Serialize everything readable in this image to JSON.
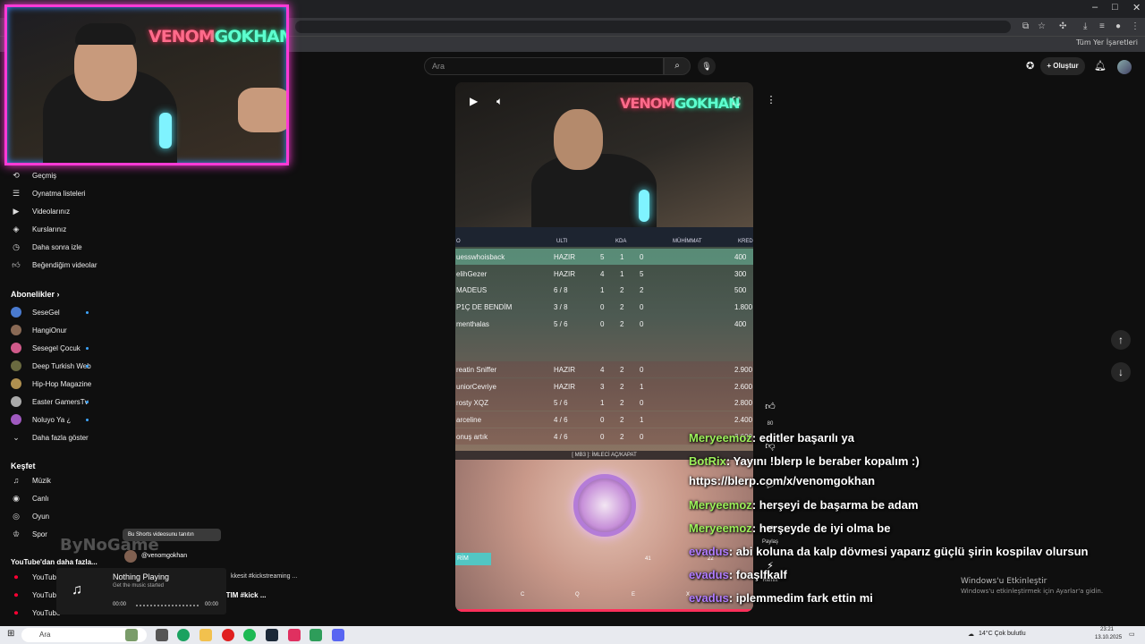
{
  "webcam": {
    "neon_a": "VENOM",
    "neon_b": "GOKHAN"
  },
  "browser": {
    "bookmarks_label": "Tüm Yer İşaretleri",
    "window_min": "–",
    "window_max": "□",
    "window_close": "✕"
  },
  "header": {
    "search_placeholder": "Ara",
    "create_label": "Oluştur"
  },
  "sidebar": {
    "you_items": [
      {
        "label": "Geçmiş",
        "icon": "history-icon"
      },
      {
        "label": "Oynatma listeleri",
        "icon": "playlist-icon"
      },
      {
        "label": "Videolarınız",
        "icon": "your-videos-icon"
      },
      {
        "label": "Kurslarınız",
        "icon": "courses-icon"
      },
      {
        "label": "Daha sonra izle",
        "icon": "watch-later-icon"
      },
      {
        "label": "Beğendiğim videolar",
        "icon": "like-icon"
      }
    ],
    "subs_heading": "Abonelikler",
    "subs_chevron": "›",
    "subscriptions": [
      {
        "label": "SeseGel",
        "color": "#4a7bd0",
        "live": true
      },
      {
        "label": "HangiOnur",
        "color": "#8a6a55",
        "live": false
      },
      {
        "label": "Sesegel Çocuk",
        "color": "#d05a8a",
        "live": true
      },
      {
        "label": "Deep Turkish Web",
        "color": "#6a6a40",
        "live": true
      },
      {
        "label": "Hip-Hop Magazine",
        "color": "#b09050",
        "live": false
      },
      {
        "label": "Easter GamersTv",
        "color": "#aaa",
        "live": true
      },
      {
        "label": "Noluyo Ya ¿",
        "color": "#a05ac0",
        "live": true
      }
    ],
    "show_more": "Daha fazla göster",
    "explore_heading": "Keşfet",
    "explore_items": [
      {
        "label": "Müzik",
        "icon": "music-icon"
      },
      {
        "label": "Canlı",
        "icon": "live-icon"
      },
      {
        "label": "Oyun",
        "icon": "gaming-icon"
      },
      {
        "label": "Spor",
        "icon": "trophy-icon"
      }
    ],
    "more_heading": "YouTube'dan daha fazla...",
    "more_items": [
      "YouTube",
      "YouTube",
      "YouTube"
    ]
  },
  "scoreboard": {
    "headers": {
      "a": "O",
      "ulti": "ULTI",
      "kda": "KDA",
      "ammo": "MÜHİMMAT",
      "credits": "KRED"
    },
    "team_a": [
      {
        "name": "uesswhoisback",
        "ulti": "HAZIR",
        "k": "5",
        "d": "1",
        "a": "0",
        "credits": "400"
      },
      {
        "name": "elihGezer",
        "ulti": "HAZIR",
        "k": "4",
        "d": "1",
        "a": "5",
        "credits": "300"
      },
      {
        "name": "MADEUS",
        "ulti": "6 / 8",
        "k": "1",
        "d": "2",
        "a": "2",
        "credits": "500"
      },
      {
        "name": "P1Ç DE BENDİM",
        "ulti": "3 / 8",
        "k": "0",
        "d": "2",
        "a": "0",
        "credits": "1.800"
      },
      {
        "name": "menthalas",
        "ulti": "5 / 6",
        "k": "0",
        "d": "2",
        "a": "0",
        "credits": "400"
      }
    ],
    "team_b": [
      {
        "name": "reatin Sniffer",
        "ulti": "HAZIR",
        "k": "4",
        "d": "2",
        "a": "0",
        "credits": "2.900"
      },
      {
        "name": "uniorCevriye",
        "ulti": "HAZIR",
        "k": "3",
        "d": "2",
        "a": "1",
        "credits": "2.600"
      },
      {
        "name": "rosty XQZ",
        "ulti": "5 / 6",
        "k": "1",
        "d": "2",
        "a": "0",
        "credits": "2.800"
      },
      {
        "name": "arceline",
        "ulti": "4 / 6",
        "k": "0",
        "d": "2",
        "a": "1",
        "credits": "2.400"
      },
      {
        "name": "onuş artık",
        "ulti": "4 / 6",
        "k": "0",
        "d": "2",
        "a": "0",
        "credits": "2.600"
      }
    ],
    "mb3_hint": "[ MB3 ]: İMLECİ AÇ/KAPAT",
    "rim_tag": "RİM",
    "abilities": [
      "C",
      "Q",
      "E",
      "X"
    ],
    "ammo_count": "41",
    "ammo_reserve": "22"
  },
  "actions": {
    "like_count": "80",
    "share_label": "Paylaş",
    "more_label": "Remix"
  },
  "chat": [
    {
      "user": "Meryeemoz",
      "user_color": "#9cf05a",
      "text": ": editler başarılı ya"
    },
    {
      "user": "BotRix",
      "user_color": "#9cf05a",
      "text": ": Yayını !blerp le beraber kopalım :)"
    },
    {
      "user": "",
      "user_color": "#ffffff",
      "text": "https://blerp.com/x/venomgokhan"
    },
    {
      "user": "Meryeemoz",
      "user_color": "#9cf05a",
      "text": ": herşeyi de başarma be adam"
    },
    {
      "user": "Meryeemoz",
      "user_color": "#9cf05a",
      "text": ": herşeyde de iyi olma be"
    },
    {
      "user": "evadus",
      "user_color": "#b07cff",
      "text": ": abi koluna da kalp dövmesi yaparız güçlü şirin kospilav olursun"
    },
    {
      "user": "evadus",
      "user_color": "#b07cff",
      "text": ": foaşlfkalf"
    },
    {
      "user": "evadus",
      "user_color": "#b07cff",
      "text": ": iplemmedim fark ettin mi"
    }
  ],
  "windows": {
    "activate_title": "Windows'u Etkinleştir",
    "activate_sub": "Windows'u etkinleştirmek için Ayarlar'a gidin."
  },
  "mini": {
    "tooltip": "Bu Shorts videosunu tanıtın",
    "handle": "@venomgokhan",
    "watermark": "ByNoGame",
    "music_title": "Nothing Playing",
    "music_sub": "Get the music started",
    "time_start": "00:00",
    "time_end": "00:00",
    "tags": "kkesit #kickstreaming ...",
    "title": "YENİ AJAN VETO İLE BELA ATTIM #kick ..."
  },
  "taskbar": {
    "search": "Ara",
    "weather": "14°C  Çok bulutlu",
    "time": "23:21",
    "date": "13.10.2025"
  }
}
